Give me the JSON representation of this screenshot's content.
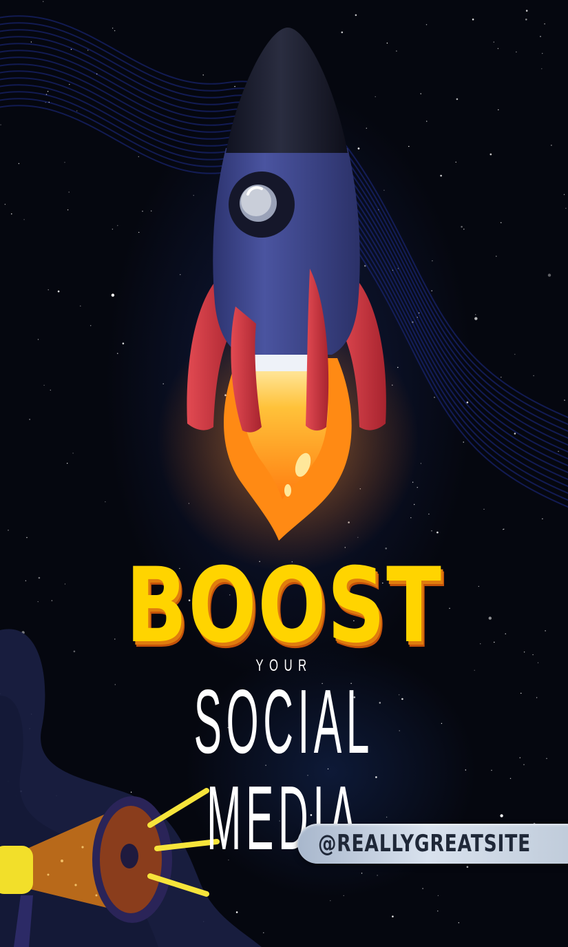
{
  "poster": {
    "headline": "BOOST",
    "subline_small": "YOUR",
    "subline_large": "SOCIAL MEDIA",
    "handle": "@REALLYGREATSITE"
  },
  "colors": {
    "background": "#05070f",
    "headline": "#ffd400",
    "headline_shadow": "#e07d0e",
    "rocket_body": "#434c92",
    "rocket_fins": "#c9353f",
    "rocket_nose": "#1b1d2c",
    "flame": "#ff9a1e",
    "pill": "#c8d3e2"
  },
  "icons": [
    "rocket-icon",
    "megaphone-icon",
    "stars-background",
    "wave-lines"
  ]
}
